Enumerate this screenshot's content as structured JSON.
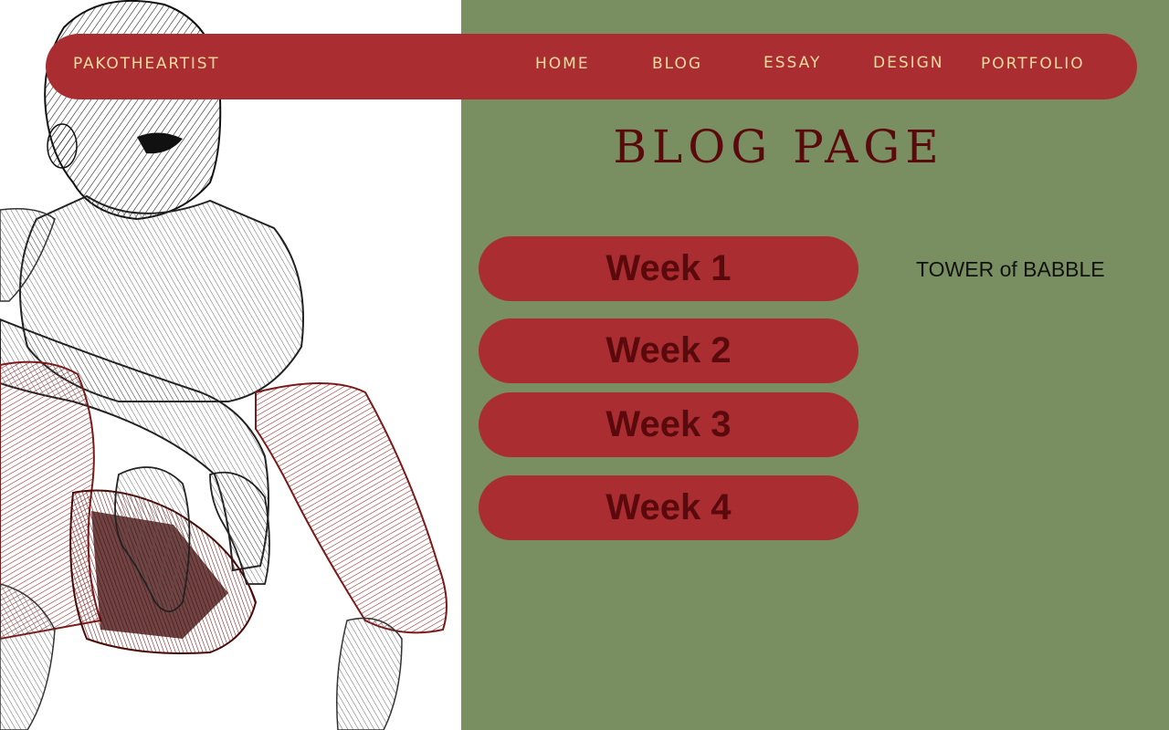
{
  "nav": {
    "brand": "PAKOTHEARTIST",
    "links": [
      "HOME",
      "BLOG",
      "ESSAY",
      "DESIGN",
      "PORTFOLIO"
    ]
  },
  "main": {
    "title": "BLOG PAGE",
    "weeks": [
      "Week 1",
      "Week 2",
      "Week 3",
      "Week 4"
    ],
    "side_link": "TOWER of BABBLE"
  },
  "illustration": {
    "subject": "pencil sketch of a crouching boy in red trousers"
  },
  "colors": {
    "accent_red": "#aa2e31",
    "dark_maroon": "#5a0a0c",
    "olive_green": "#7a8f61",
    "nav_text": "#f3dba0"
  }
}
